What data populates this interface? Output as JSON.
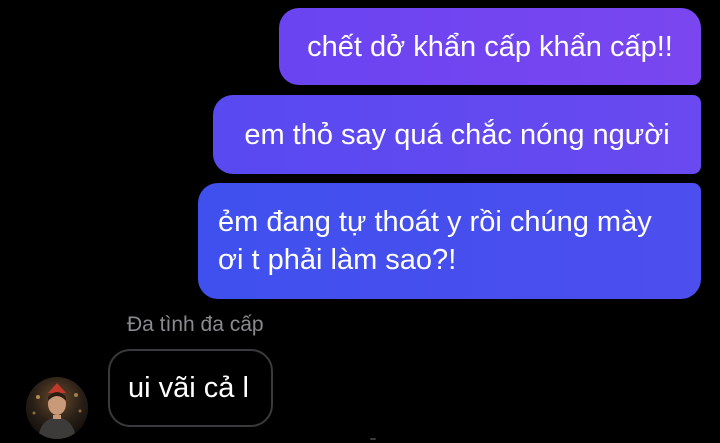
{
  "messages": {
    "outgoing": [
      {
        "text": "chết dở khẩn cấp khẩn cấp!!"
      },
      {
        "text": "em thỏ say quá chắc nóng người"
      },
      {
        "text": "ẻm đang tự thoát y rồi chúng mày ơi t phải làm sao?!"
      }
    ],
    "incoming": {
      "sender": "Đa tình đa cấp",
      "text": "ui vãi cả l"
    }
  },
  "colors": {
    "background": "#000000",
    "bubble_top": "#7a46f0",
    "bubble_mid": "#5849f1",
    "bubble_bottom": "#3f50ee",
    "incoming_border": "#3a3a3c",
    "sender_name": "#8a8a8e"
  },
  "icons": {
    "avatar": "user-avatar-photo"
  }
}
